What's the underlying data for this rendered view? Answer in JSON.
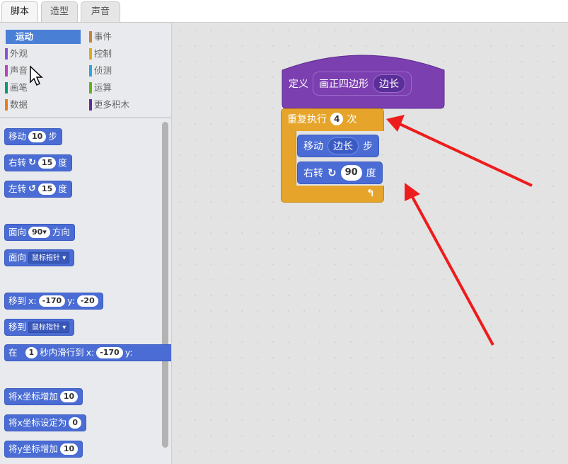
{
  "tabs": [
    "脚本",
    "造型",
    "声音"
  ],
  "categories": [
    {
      "label": "运动",
      "color": "#4a6cd4",
      "selected": true
    },
    {
      "label": "事件",
      "color": "#c88330"
    },
    {
      "label": "外观",
      "color": "#8a55d7"
    },
    {
      "label": "控制",
      "color": "#e1a91a"
    },
    {
      "label": "声音",
      "color": "#bb42c3"
    },
    {
      "label": "侦测",
      "color": "#2ca5e2"
    },
    {
      "label": "画笔",
      "color": "#0e9a6c"
    },
    {
      "label": "运算",
      "color": "#5cb712"
    },
    {
      "label": "数据",
      "color": "#ee7d16"
    },
    {
      "label": "更多积木",
      "color": "#632d99"
    }
  ],
  "palette": {
    "move": {
      "label": "移动",
      "value": "10",
      "suffix": "步"
    },
    "turn_right": {
      "label": "右转",
      "value": "15",
      "suffix": "度"
    },
    "turn_left": {
      "label": "左转",
      "value": "15",
      "suffix": "度"
    },
    "point_dir": {
      "label": "面向",
      "value": "90▾",
      "suffix": "方向"
    },
    "point_towards": {
      "label": "面向",
      "dropdown": "鼠标指针 ▾"
    },
    "goto_xy": {
      "label": "移到",
      "x_label": "x:",
      "x": "-170",
      "y_label": "y:",
      "y": "-20"
    },
    "goto": {
      "label": "移到",
      "dropdown": "鼠标指针 ▾"
    },
    "glide": {
      "label": "在",
      "secs": "1",
      "text": "秒内滑行到",
      "x_label": "x:",
      "x": "-170",
      "y_label": "y:"
    },
    "change_x": {
      "label": "将x坐标增加",
      "value": "10"
    },
    "set_x": {
      "label": "将x坐标设定为",
      "value": "0"
    },
    "change_y": {
      "label": "将y坐标增加",
      "value": "10"
    }
  },
  "script": {
    "define": {
      "label": "定义",
      "name": "画正四边形",
      "param": "边长"
    },
    "repeat": {
      "label": "重复执行",
      "count": "4",
      "suffix": "次"
    },
    "move": {
      "label": "移动",
      "param": "边长",
      "suffix": "步"
    },
    "turn": {
      "label": "右转",
      "value": "90",
      "suffix": "度"
    }
  },
  "colors": {
    "motion": "#4a6cd4",
    "control": "#e6a52a",
    "custom": "#7b3fb0",
    "annotation_arrow": "#ee1c1c"
  }
}
